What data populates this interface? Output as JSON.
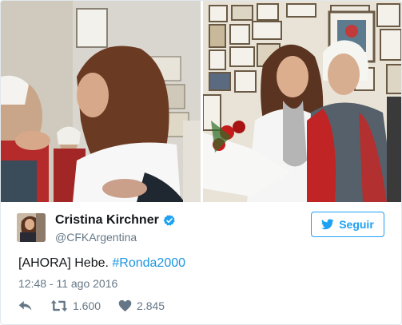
{
  "tweet": {
    "display_name": "Cristina Kirchner",
    "handle": "@CFKArgentina",
    "text_prefix": "[AHORA] Hebe. ",
    "hashtag": "#Ronda2000",
    "timestamp": "12:48 - 11 ago 2016",
    "follow_label": "Seguir",
    "retweets": "1.600",
    "likes": "2.845",
    "verified": true
  },
  "colors": {
    "accent": "#1da1f2",
    "hashtag": "#1b95e0",
    "secondary_text": "#657786"
  },
  "icons": {
    "verified": "verified-badge-icon",
    "follow": "twitter-bird-icon",
    "reply": "reply-icon",
    "retweet": "retweet-icon",
    "like": "heart-icon"
  }
}
